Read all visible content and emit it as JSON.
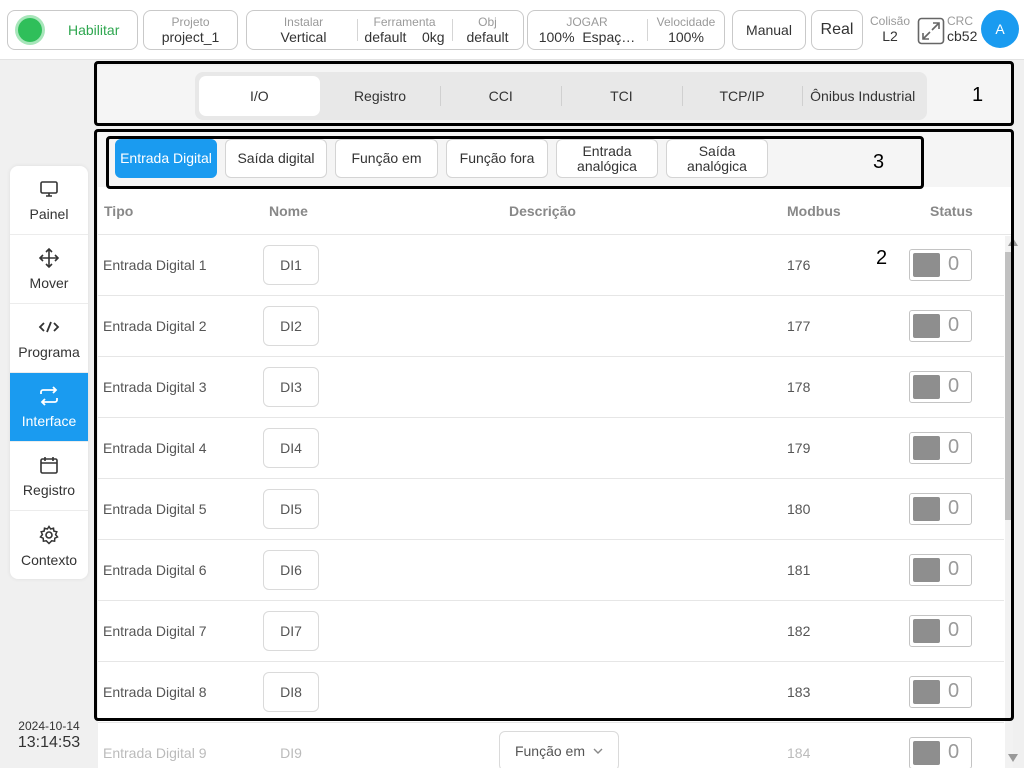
{
  "topbar": {
    "enable_label": "Habilitar",
    "project": {
      "label": "Projeto",
      "value": "project_1"
    },
    "install": {
      "label": "Instalar",
      "value": "Vertical"
    },
    "tool": {
      "label": "Ferramenta",
      "value": "default",
      "weight": "0kg"
    },
    "obj": {
      "label": "Obj",
      "value": "default"
    },
    "jog": {
      "label": "JOGAR",
      "value": "100%",
      "space": "Espaç…"
    },
    "speed": {
      "label": "Velocidade",
      "value": "100%"
    },
    "mode_label": "Manual",
    "real_label": "Real",
    "collision": {
      "label": "Colisão",
      "value": "L2"
    },
    "crc": {
      "label": "CRC",
      "value": "cb52"
    },
    "avatar": "A"
  },
  "sidebar": {
    "items": [
      {
        "label": "Painel",
        "icon": "monitor-icon"
      },
      {
        "label": "Mover",
        "icon": "move-arrows-icon"
      },
      {
        "label": "Programa",
        "icon": "code-icon"
      },
      {
        "label": "Interface",
        "icon": "swap-arrows-icon"
      },
      {
        "label": "Registro",
        "icon": "calendar-icon"
      },
      {
        "label": "Contexto",
        "icon": "gear-icon"
      }
    ],
    "active": "Interface"
  },
  "datetime": {
    "date": "2024-10-14",
    "time": "13:14:53"
  },
  "tabs": [
    "I/O",
    "Registro",
    "CCI",
    "TCI",
    "TCP/IP",
    "Ônibus Industrial"
  ],
  "subtabs": [
    "Entrada Digital",
    "Saída digital",
    "Função em",
    "Função fora",
    "Entrada analógica",
    "Saída analógica"
  ],
  "table": {
    "headers": {
      "tipo": "Tipo",
      "nome": "Nome",
      "descricao": "Descrição",
      "modbus": "Modbus",
      "status": "Status"
    },
    "rows": [
      {
        "tipo": "Entrada Digital 1",
        "nome": "DI1",
        "modbus": "176",
        "status": "0"
      },
      {
        "tipo": "Entrada Digital 2",
        "nome": "DI2",
        "modbus": "177",
        "status": "0"
      },
      {
        "tipo": "Entrada Digital 3",
        "nome": "DI3",
        "modbus": "178",
        "status": "0"
      },
      {
        "tipo": "Entrada Digital 4",
        "nome": "DI4",
        "modbus": "179",
        "status": "0"
      },
      {
        "tipo": "Entrada Digital 5",
        "nome": "DI5",
        "modbus": "180",
        "status": "0"
      },
      {
        "tipo": "Entrada Digital 6",
        "nome": "DI6",
        "modbus": "181",
        "status": "0"
      },
      {
        "tipo": "Entrada Digital 7",
        "nome": "DI7",
        "modbus": "182",
        "status": "0"
      },
      {
        "tipo": "Entrada Digital 8",
        "nome": "DI8",
        "modbus": "183",
        "status": "0"
      },
      {
        "tipo": "Entrada Digital 9",
        "nome": "DI9",
        "funcao": "Função em",
        "modbus": "184",
        "status": "0"
      }
    ]
  },
  "annotations": {
    "tabs": "1",
    "table": "2",
    "subtabs": "3"
  }
}
